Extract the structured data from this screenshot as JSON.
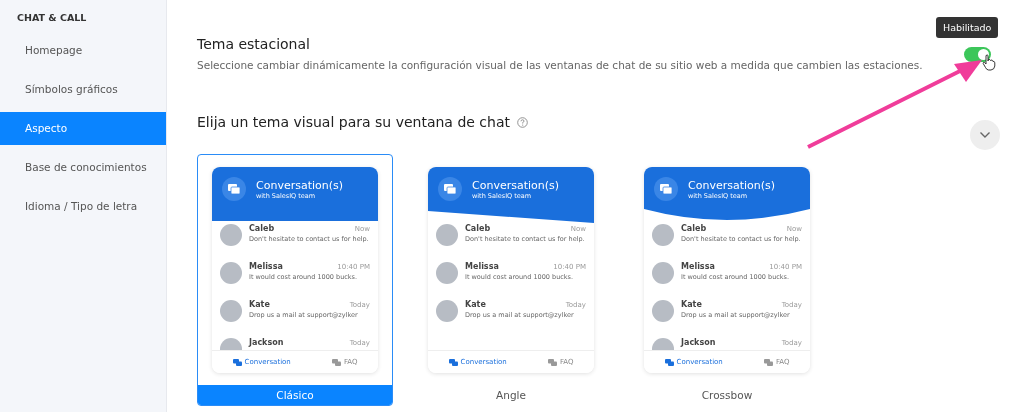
{
  "sidebar": {
    "heading": "CHAT & CALL",
    "items": [
      {
        "label": "Homepage",
        "selected": false
      },
      {
        "label": "Símbolos gráficos",
        "selected": false
      },
      {
        "label": "Aspecto",
        "selected": true
      },
      {
        "label": "Base de conocimientos",
        "selected": false
      },
      {
        "label": "Idioma / Tipo de letra",
        "selected": false
      }
    ]
  },
  "seasonal": {
    "title": "Tema estacional",
    "description": "Seleccione cambiar dinámicamente la configuración visual de las ventanas de chat de su sitio web a medida que cambien las estaciones.",
    "toggle": {
      "on": true,
      "tooltip": "Habilitado"
    }
  },
  "themes_section": {
    "title": "Elija un tema visual para su ventana de chat"
  },
  "themes": [
    {
      "kind": "classic",
      "label": "Clásico",
      "selected": true,
      "header_title": "Conversation(s)",
      "header_subtitle": "with SalesIQ team",
      "contacts": [
        {
          "name": "Caleb",
          "time": "Now",
          "message": "Don't hesitate to contact us for help."
        },
        {
          "name": "Melissa",
          "time": "10:40 PM",
          "message": "It would cost around 1000 bucks."
        },
        {
          "name": "Kate",
          "time": "Today",
          "message": "Drop us a mail at support@zylker"
        },
        {
          "name": "Jackson",
          "time": "Today"
        }
      ],
      "tabs": [
        "Conversation",
        "FAQ"
      ]
    },
    {
      "kind": "angle",
      "label": "Angle",
      "selected": false,
      "header_title": "Conversation(s)",
      "header_subtitle": "with SalesIQ team",
      "contacts": [
        {
          "name": "Caleb",
          "time": "Now",
          "message": "Don't hesitate to contact us for help."
        },
        {
          "name": "Melissa",
          "time": "10:40 PM",
          "message": "It would cost around 1000 bucks."
        },
        {
          "name": "Kate",
          "time": "Today",
          "message": "Drop us a mail at support@zylker"
        }
      ],
      "tabs": [
        "Conversation",
        "FAQ"
      ]
    },
    {
      "kind": "crossbow",
      "label": "Crossbow",
      "selected": false,
      "header_title": "Conversation(s)",
      "header_subtitle": "with SalesIQ team",
      "contacts": [
        {
          "name": "Caleb",
          "time": "Now",
          "message": "Don't hesitate to contact us for help."
        },
        {
          "name": "Melissa",
          "time": "10:40 PM",
          "message": "It would cost around 1000 bucks."
        },
        {
          "name": "Kate",
          "time": "Today",
          "message": "Drop us a mail at support@zylker"
        },
        {
          "name": "Jackson",
          "time": "Today"
        }
      ],
      "tabs": [
        "Conversation",
        "FAQ"
      ]
    }
  ]
}
